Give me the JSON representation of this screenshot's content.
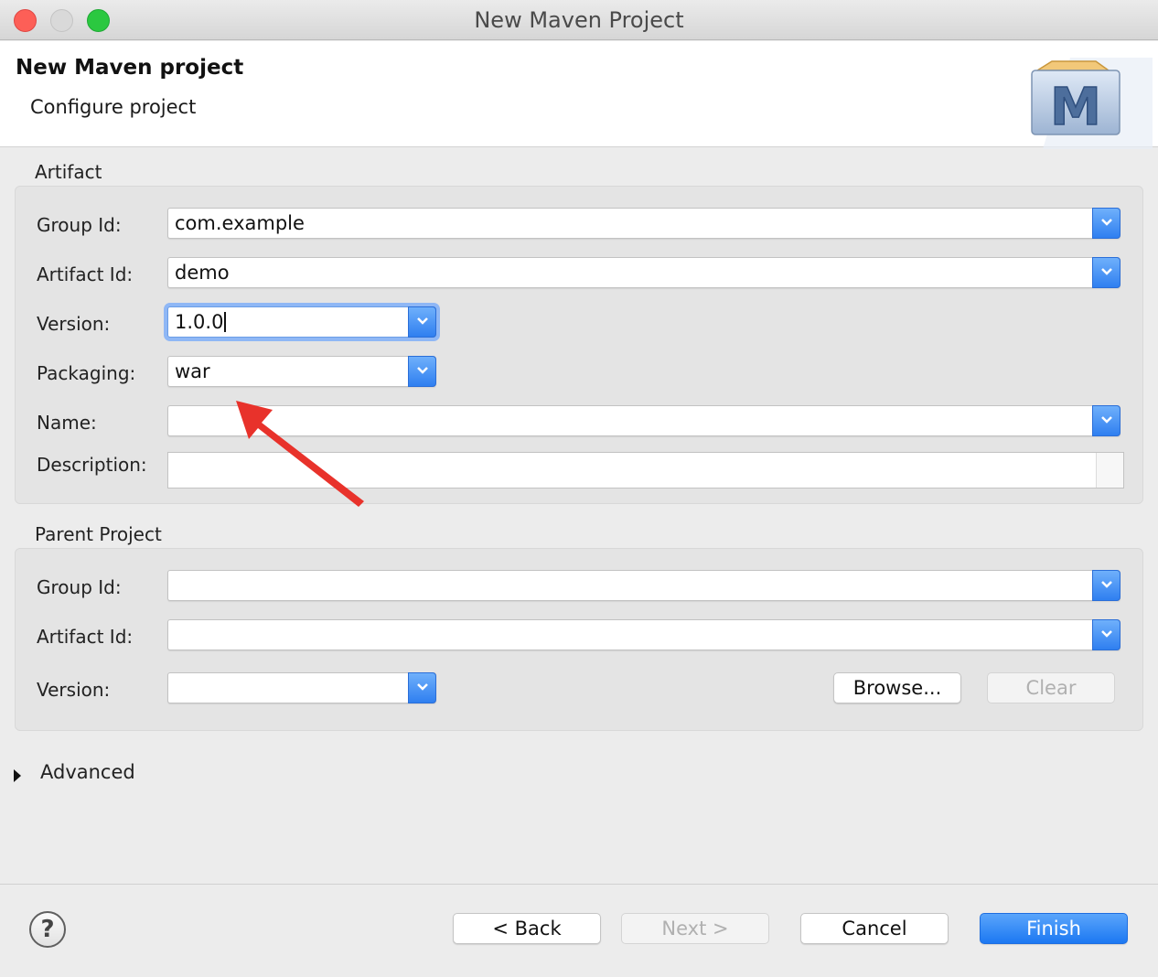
{
  "window": {
    "title": "New Maven Project"
  },
  "header": {
    "title": "New Maven project",
    "subtitle": "Configure project",
    "logo_letter": "M"
  },
  "artifact": {
    "title": "Artifact",
    "group_id": {
      "label": "Group Id:",
      "value": "com.example"
    },
    "artifact_id": {
      "label": "Artifact Id:",
      "value": "demo"
    },
    "version": {
      "label": "Version:",
      "value": "1.0.0"
    },
    "packaging": {
      "label": "Packaging:",
      "value": "war"
    },
    "name": {
      "label": "Name:",
      "value": ""
    },
    "description": {
      "label": "Description:",
      "value": ""
    }
  },
  "parent": {
    "title": "Parent Project",
    "group_id": {
      "label": "Group Id:",
      "value": ""
    },
    "artifact_id": {
      "label": "Artifact Id:",
      "value": ""
    },
    "version": {
      "label": "Version:",
      "value": ""
    },
    "browse_label": "Browse...",
    "clear_label": "Clear"
  },
  "advanced": {
    "label": "Advanced"
  },
  "footer": {
    "help_glyph": "?",
    "back_label": "< Back",
    "next_label": "Next >",
    "cancel_label": "Cancel",
    "finish_label": "Finish"
  },
  "colors": {
    "accent": "#2f7ff0",
    "annotation_arrow": "#e8322b"
  },
  "icons": [
    "close-icon",
    "minimize-icon",
    "maximize-icon",
    "maven-logo",
    "chevron-down-icon",
    "disclosure-triangle-icon",
    "help-icon",
    "annotation-arrow"
  ]
}
